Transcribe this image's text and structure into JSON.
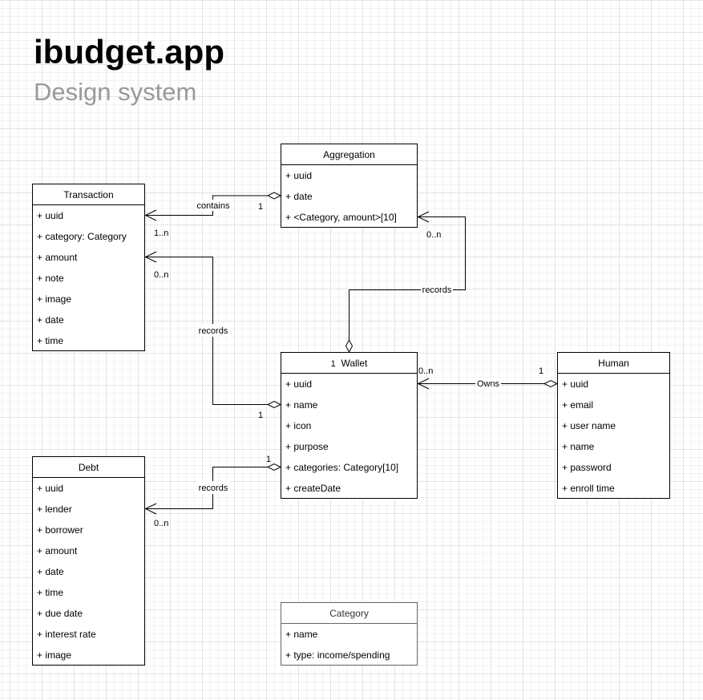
{
  "header": {
    "title": "ibudget.app",
    "subtitle": "Design system"
  },
  "classes": {
    "aggregation": {
      "name": "Aggregation",
      "attributes": [
        "+ uuid",
        "+ date",
        "+ <Category, amount>[10]"
      ]
    },
    "transaction": {
      "name": "Transaction",
      "attributes": [
        "+ uuid",
        "+ category: Category",
        "+ amount",
        "+ note",
        "+ image",
        "+ date",
        "+ time"
      ]
    },
    "wallet": {
      "name": "Wallet",
      "multiplicity": "1",
      "attributes": [
        "+ uuid",
        "+ name",
        "+ icon",
        "+ purpose",
        "+ categories: Category[10]",
        "+ createDate"
      ]
    },
    "human": {
      "name": "Human",
      "attributes": [
        "+ uuid",
        "+ email",
        "+ user name",
        "+ name",
        "+ password",
        "+ enroll time"
      ]
    },
    "debt": {
      "name": "Debt",
      "attributes": [
        "+ uuid",
        "+ lender",
        "+ borrower",
        "+ amount",
        "+ date",
        "+ time",
        "+ due date",
        "+ interest rate",
        "+ image"
      ]
    },
    "category": {
      "name": "Category",
      "attributes": [
        "+ name",
        "+ type: income/spending"
      ]
    }
  },
  "relations": {
    "aggregation_transaction": {
      "label": "contains",
      "source_mult": "1",
      "target_mult": "1..n"
    },
    "wallet_aggregation": {
      "label": "records",
      "target_mult": "0..n"
    },
    "wallet_transaction": {
      "label": "records",
      "source_mult": "1",
      "target_mult": "0..n"
    },
    "human_wallet": {
      "label": "Owns",
      "source_mult": "1",
      "target_mult": "0..n"
    },
    "wallet_debt": {
      "label": "records",
      "source_mult": "1",
      "target_mult": "0..n"
    }
  }
}
